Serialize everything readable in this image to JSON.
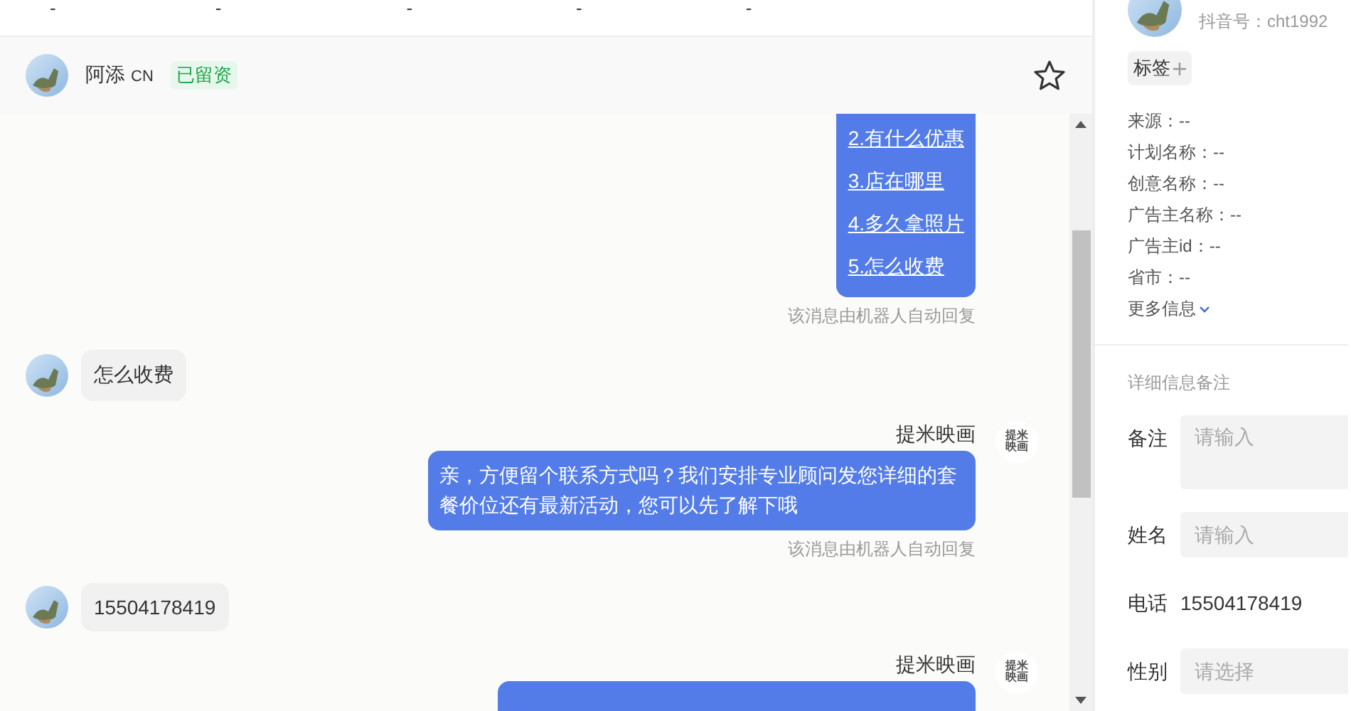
{
  "top_bar": {
    "cells": [
      "-",
      "-",
      "-",
      "-",
      "-"
    ]
  },
  "contact": {
    "name": "阿添",
    "suffix": "CN",
    "badge": "已留资",
    "starred": false
  },
  "messages": [
    {
      "kind": "bot",
      "links": [
        "2.有什么优惠",
        "3.店在哪里",
        "4.多久拿照片",
        "5.怎么收费"
      ],
      "note": "该消息由机器人自动回复"
    },
    {
      "kind": "user",
      "text": "怎么收费"
    },
    {
      "kind": "bot",
      "sender": "提米映画",
      "avatar_text": "提米映画",
      "text": "亲，方便留个联系方式吗？我们安排专业顾问发您详细的套餐价位还有最新活动，您可以先了解下哦",
      "note": "该消息由机器人自动回复"
    },
    {
      "kind": "user",
      "text": "15504178419"
    },
    {
      "kind": "bot",
      "sender": "提米映画",
      "avatar_text": "提米映画"
    }
  ],
  "profile": {
    "account": "抖音号：cht1992",
    "tag_button": "标签",
    "info": [
      "来源：--",
      "计划名称：--",
      "创意名称：--",
      "广告主名称：--",
      "广告主id：--",
      "省市：--"
    ],
    "more": "更多信息"
  },
  "notes": {
    "title": "详细信息备注",
    "fields": [
      {
        "kind": "textarea",
        "label": "备注",
        "placeholder": "请输入"
      },
      {
        "kind": "input",
        "label": "姓名",
        "placeholder": "请输入"
      },
      {
        "kind": "text",
        "label": "电话",
        "value": "15504178419"
      },
      {
        "kind": "select",
        "label": "性别",
        "placeholder": "请选择"
      }
    ]
  }
}
